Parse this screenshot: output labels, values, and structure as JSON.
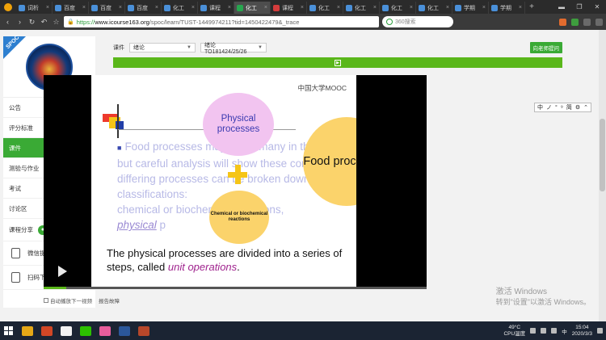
{
  "browser": {
    "tabs": [
      {
        "label": "词析",
        "fav": "b",
        "active": false
      },
      {
        "label": "百度",
        "fav": "b",
        "active": false
      },
      {
        "label": "百度",
        "fav": "b",
        "active": false
      },
      {
        "label": "百度",
        "fav": "b",
        "active": false
      },
      {
        "label": "化工",
        "fav": "b",
        "active": false
      },
      {
        "label": "课程",
        "fav": "b",
        "active": false
      },
      {
        "label": "化工",
        "fav": "g",
        "active": true
      },
      {
        "label": "课程",
        "fav": "c",
        "active": false
      },
      {
        "label": "化工",
        "fav": "b",
        "active": false
      },
      {
        "label": "化工",
        "fav": "b",
        "active": false
      },
      {
        "label": "化工",
        "fav": "b",
        "active": false
      },
      {
        "label": "化工",
        "fav": "b",
        "active": false
      },
      {
        "label": "学期",
        "fav": "b",
        "active": false
      },
      {
        "label": "学期",
        "fav": "b",
        "active": false
      }
    ],
    "tab_close": "×",
    "new_tab": "+",
    "url": {
      "scheme": "https://",
      "host": "www.icourse163.org",
      "path": "/spoc/learn/TUST-1449974211?tid=1450422479&_trace"
    },
    "search_placeholder": "360搜索",
    "nav": {
      "back": "‹",
      "forward": "›",
      "reload": "↻",
      "undo": "↶",
      "home": "☆"
    }
  },
  "sidebar": {
    "spoc_badge": "SPOC",
    "menu": [
      {
        "label": "公告",
        "active": false
      },
      {
        "label": "评分标准",
        "active": false
      },
      {
        "label": "课件",
        "active": true
      },
      {
        "label": "测验与作业",
        "active": false
      },
      {
        "label": "考试",
        "active": false
      },
      {
        "label": "讨论区",
        "active": false
      }
    ],
    "share_label": "课程分享",
    "tools": [
      {
        "label": "微信提醒课程进度",
        "icon": "mobile-reminder-icon"
      },
      {
        "label": "扫码下载APP",
        "icon": "phone-download-icon"
      }
    ]
  },
  "content": {
    "crumb_label": "课件",
    "chapter_select": "绪论",
    "lesson_select": "绪论TO181424/25/26",
    "ask_button": "向老师提问"
  },
  "slide": {
    "brand": "中国大学MOOC",
    "bubble_physical": "Physical processes",
    "bubble_food": "Food processing",
    "bubble_chemical": "Chemical or biochemical reactions",
    "paragraph": "Food processes may seem many in their diversity, but careful analysis will show these complicated and differing processes can be broken down into two classifications:",
    "para_line2": "chemical or biochemical reactions,",
    "para_physical": "physical",
    "para_tail": "p",
    "sentence_main": "The physical processes are divided into a series of steps, called ",
    "sentence_term": "unit operations",
    "sentence_end": "."
  },
  "video": {
    "progress": 0.06
  },
  "below_video": {
    "autoplay": "自动播放下一视频",
    "report": "报告故障"
  },
  "watermark": {
    "line1": "激活 Windows",
    "line2": "转到\"设置\"以激活 Windows。"
  },
  "ime": [
    "中",
    "ノ",
    "°",
    "⁹",
    "简",
    "⚙",
    "⌃"
  ],
  "taskbar": {
    "temp": "49°C",
    "cpu": "CPU温度",
    "ime_lang": "中",
    "time": "15:04",
    "date": "2020/3/3"
  },
  "colors": {
    "accent_green": "#3aaa35",
    "tab_bar": "#2b2b2b",
    "bubble_pink": "#f2c4f0",
    "bubble_yellow": "#fbd36b"
  }
}
